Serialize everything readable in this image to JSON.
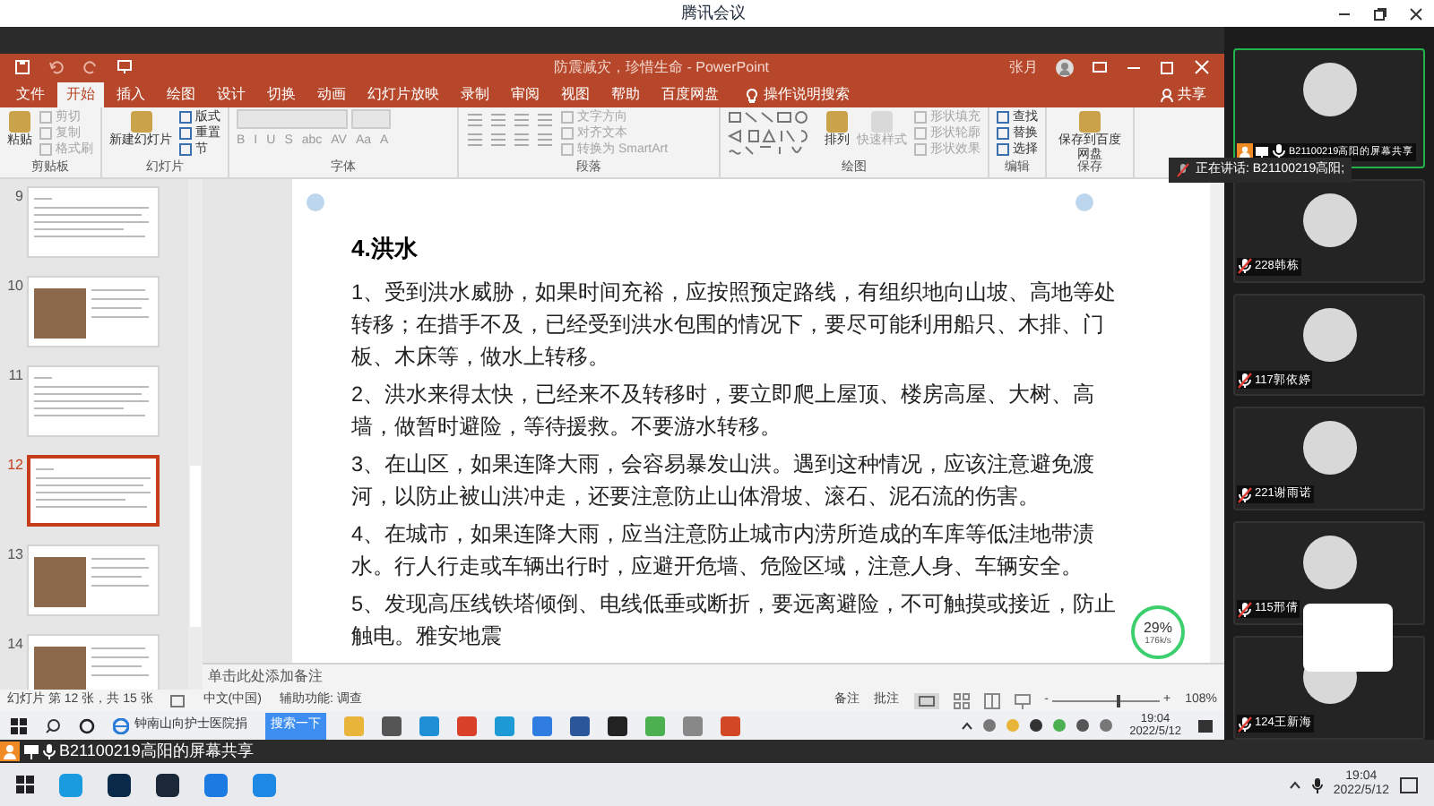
{
  "meeting_window": {
    "title": "腾讯会议"
  },
  "ppt": {
    "title": "防震减灾，珍惜生命 - PowerPoint",
    "user": "张月",
    "tell_me": "操作说明搜索",
    "share": "共享",
    "tabs": [
      {
        "label": "文件",
        "selected": false
      },
      {
        "label": "开始",
        "selected": true
      },
      {
        "label": "插入",
        "selected": false
      },
      {
        "label": "绘图",
        "selected": false
      },
      {
        "label": "设计",
        "selected": false
      },
      {
        "label": "切换",
        "selected": false
      },
      {
        "label": "动画",
        "selected": false
      },
      {
        "label": "幻灯片放映",
        "selected": false
      },
      {
        "label": "录制",
        "selected": false
      },
      {
        "label": "审阅",
        "selected": false
      },
      {
        "label": "视图",
        "selected": false
      },
      {
        "label": "帮助",
        "selected": false
      },
      {
        "label": "百度网盘",
        "selected": false
      }
    ],
    "ribbon": [
      {
        "name": "剪贴板",
        "kind": "buttons",
        "items": [
          {
            "label": "粘贴",
            "kind": "large",
            "disabled": false
          },
          {
            "label": "剪切",
            "kind": "small",
            "disabled": true
          },
          {
            "label": "复制",
            "kind": "small",
            "disabled": true
          },
          {
            "label": "格式刷",
            "kind": "small",
            "disabled": true
          }
        ]
      },
      {
        "name": "幻灯片",
        "kind": "buttons",
        "items": [
          {
            "label": "新建幻灯片",
            "kind": "large",
            "disabled": false
          },
          {
            "label": "版式",
            "kind": "small",
            "disabled": false
          },
          {
            "label": "重置",
            "kind": "small",
            "disabled": false
          },
          {
            "label": "节",
            "kind": "small",
            "disabled": false
          }
        ]
      },
      {
        "name": "字体",
        "kind": "font",
        "glyphs": [
          "B",
          "I",
          "U",
          "S",
          "abc",
          "AV",
          "Aa",
          "A"
        ]
      },
      {
        "name": "段落",
        "kind": "paragraph",
        "items": [
          {
            "label": "文字方向",
            "kind": "small",
            "disabled": true
          },
          {
            "label": "对齐文本",
            "kind": "small",
            "disabled": true
          },
          {
            "label": "转换为 SmartArt",
            "kind": "small",
            "disabled": true
          }
        ]
      },
      {
        "name": "绘图",
        "kind": "drawing",
        "items": [
          {
            "label": "排列",
            "kind": "large",
            "disabled": false
          },
          {
            "label": "快速样式",
            "kind": "large",
            "disabled": true
          },
          {
            "label": "形状填充",
            "kind": "small",
            "disabled": true
          },
          {
            "label": "形状轮廓",
            "kind": "small",
            "disabled": true
          },
          {
            "label": "形状效果",
            "kind": "small",
            "disabled": true
          }
        ]
      },
      {
        "name": "编辑",
        "kind": "buttons",
        "items": [
          {
            "label": "查找",
            "kind": "small",
            "disabled": false
          },
          {
            "label": "替换",
            "kind": "small",
            "disabled": false
          },
          {
            "label": "选择",
            "kind": "small",
            "disabled": false
          }
        ]
      },
      {
        "name": "保存",
        "kind": "buttons",
        "items": [
          {
            "label": "保存到百度网盘",
            "kind": "large",
            "disabled": false
          }
        ]
      }
    ],
    "thumbnails": [
      {
        "number": "9",
        "kind": "text",
        "selected": false
      },
      {
        "number": "10",
        "kind": "photo",
        "selected": false
      },
      {
        "number": "11",
        "kind": "text",
        "selected": false
      },
      {
        "number": "12",
        "kind": "text",
        "selected": true
      },
      {
        "number": "13",
        "kind": "photo",
        "selected": false
      },
      {
        "number": "14",
        "kind": "photo",
        "selected": false
      }
    ],
    "slide": {
      "title": "4.洪水",
      "paragraphs": [
        "1、受到洪水威胁，如果时间充裕，应按照预定路线，有组织地向山坡、高地等处转移；在措手不及，已经受到洪水包围的情况下，要尽可能利用船只、木排、门板、木床等，做水上转移。",
        "2、洪水来得太快，已经来不及转移时，要立即爬上屋顶、楼房高屋、大树、高墙，做暂时避险，等待援救。不要游水转移。",
        "3、在山区，如果连降大雨，会容易暴发山洪。遇到这种情况，应该注意避免渡河，以防止被山洪冲走，还要注意防止山体滑坡、滚石、泥石流的伤害。",
        "4、在城市，如果连降大雨，应当注意防止城市内涝所造成的车库等低洼地带渍水。行人行走或车辆出行时，应避开危墙、危险区域，注意人身、车辆安全。",
        "5、发现高压线铁塔倾倒、电线低垂或断折，要远离避险，不可触摸或接近，防止触电。雅安地震"
      ]
    },
    "notes_placeholder": "单击此处添加备注",
    "status_bar": {
      "slide_info": "幻灯片 第 12 张，共 15 张",
      "language": "中文(中国)",
      "accessibility": "辅助功能: 调查",
      "notes": "备注",
      "comments": "批注",
      "zoom_out": "-",
      "zoom": {
        "level": 0.6
      },
      "zoom_in": "+",
      "zoom_text": "108%"
    }
  },
  "net_widget": {
    "percent": "29%",
    "speed": "176k/s"
  },
  "remote_taskbar": {
    "search_text": "钟南山向护士医院捐",
    "search_button": "搜索一下",
    "time": "19:04",
    "date": "2022/5/12"
  },
  "speaking": "正在讲话: B21100219高阳;",
  "participants": [
    {
      "name": "B21100219高阳的屏幕共享",
      "kind": "sharer",
      "muted": false
    },
    {
      "name": "228韩栋",
      "kind": "member",
      "muted": true
    },
    {
      "name": "117郭依婷",
      "kind": "member",
      "muted": true
    },
    {
      "name": "221谢雨诺",
      "kind": "member",
      "muted": true
    },
    {
      "name": "115邢倩",
      "kind": "member",
      "muted": true
    },
    {
      "name": "124王新海",
      "kind": "member",
      "muted": true
    }
  ],
  "share_bar": {
    "label": "B21100219高阳的屏幕共享"
  },
  "taskbar": {
    "time": "19:04",
    "date": "2022/5/12"
  }
}
